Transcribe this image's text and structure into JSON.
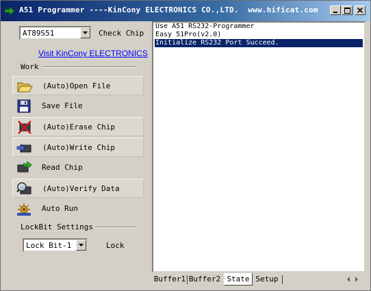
{
  "window": {
    "title": "A51 Programmer ----KinCony ELECTRONICS CO.,LTD.  www.hificat.com",
    "app_icon": "green-arrow-icon",
    "controls": [
      "minimize",
      "maximize",
      "close"
    ]
  },
  "chip_select": {
    "value": "AT89S51",
    "check_label": "Check Chip"
  },
  "link": {
    "text": "Visit KinCony ELECTRONICS"
  },
  "work": {
    "label": "Work",
    "actions": [
      {
        "label": "(Auto)Open File",
        "icon": "open-folder-icon",
        "raised": true
      },
      {
        "label": "Save File",
        "icon": "floppy-disk-icon",
        "raised": false
      },
      {
        "label": "(Auto)Erase Chip",
        "icon": "erase-chip-icon",
        "raised": true
      },
      {
        "label": "(Auto)Write Chip",
        "icon": "write-chip-icon",
        "raised": true
      },
      {
        "label": "Read Chip",
        "icon": "read-chip-icon",
        "raised": false
      },
      {
        "label": "(Auto)Verify Data",
        "icon": "verify-chip-icon",
        "raised": true
      },
      {
        "label": "Auto Run",
        "icon": "auto-run-icon",
        "raised": false
      }
    ]
  },
  "lockbit": {
    "label": "LockBit Settings",
    "value": "Lock Bit-1",
    "lock_label": "Lock"
  },
  "log": {
    "lines": [
      "Use A51 RS232-Programmer",
      "Easy 51Pro(v2.0)",
      "Initialize RS232 Port Succeed."
    ],
    "selected_index": 2
  },
  "tabs": [
    {
      "label": "Buffer1",
      "active": false
    },
    {
      "label": "Buffer2",
      "active": false
    },
    {
      "label": "State",
      "active": true
    },
    {
      "label": "Setup",
      "active": false
    }
  ],
  "colors": {
    "face": "#d4d0c8",
    "title_start": "#0a246a",
    "title_end": "#a6caf0",
    "selection": "#0a246a",
    "link": "#0000ff"
  }
}
